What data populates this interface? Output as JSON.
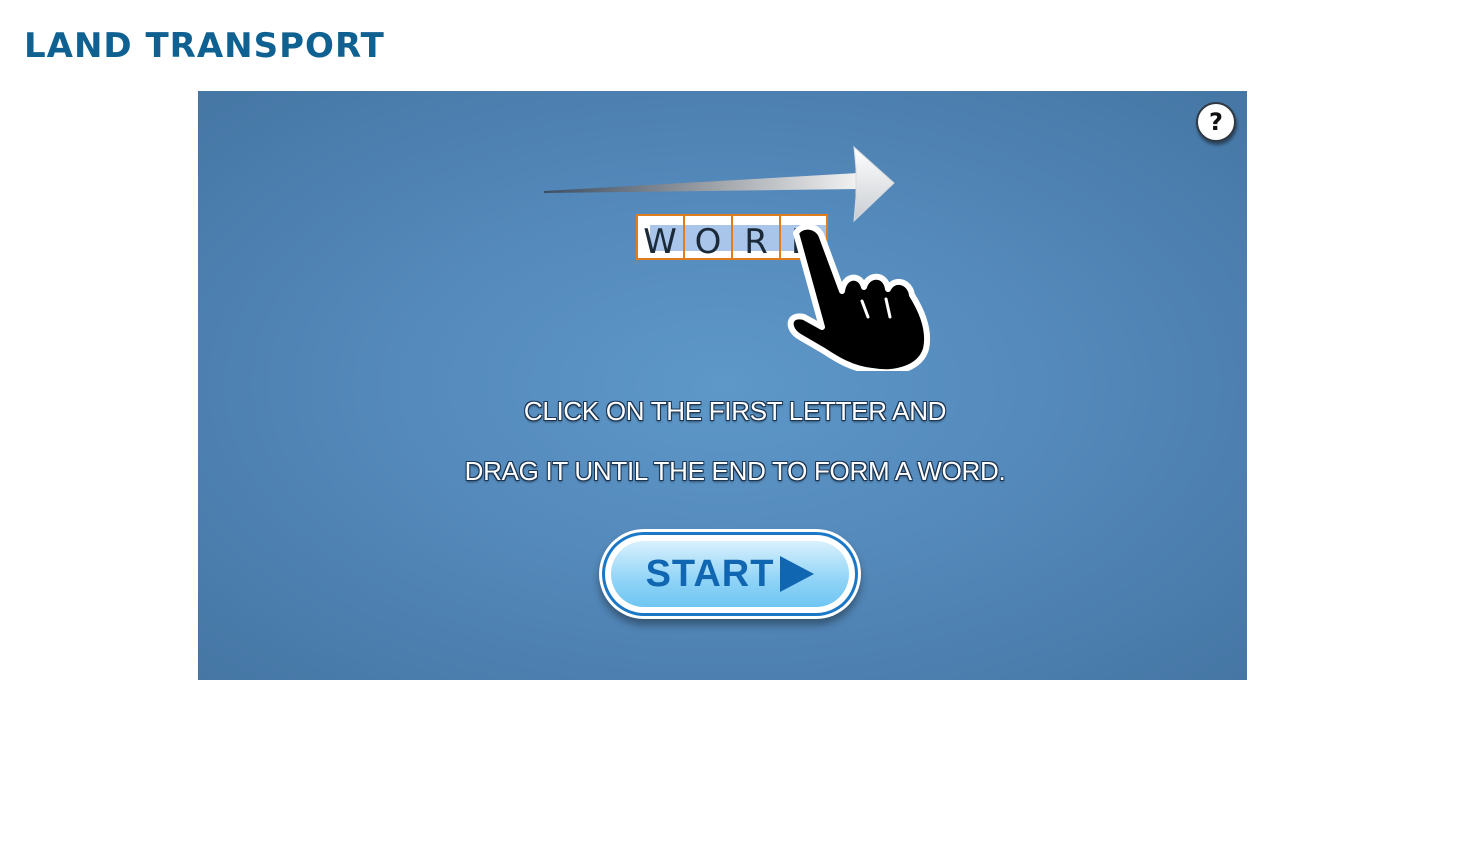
{
  "page": {
    "title": "LAND TRANSPORT"
  },
  "game": {
    "help_label": "?",
    "example_letters": [
      "W",
      "O",
      "R",
      "D"
    ],
    "instruction_line1": "CLICK ON THE FIRST LETTER AND",
    "instruction_line2": "DRAG IT UNTIL THE END TO FORM A WORD.",
    "start_label": "START",
    "icons": {
      "help": "question-mark-icon",
      "arrow": "right-arrow-icon",
      "hand": "pointing-hand-icon",
      "start_arrow": "play-arrow-icon"
    },
    "colors": {
      "title": "#0f6192",
      "background": "#5489bb",
      "letter_border": "#e07d1a",
      "highlight": "#a9c6ea",
      "start_text": "#1166b2"
    }
  }
}
